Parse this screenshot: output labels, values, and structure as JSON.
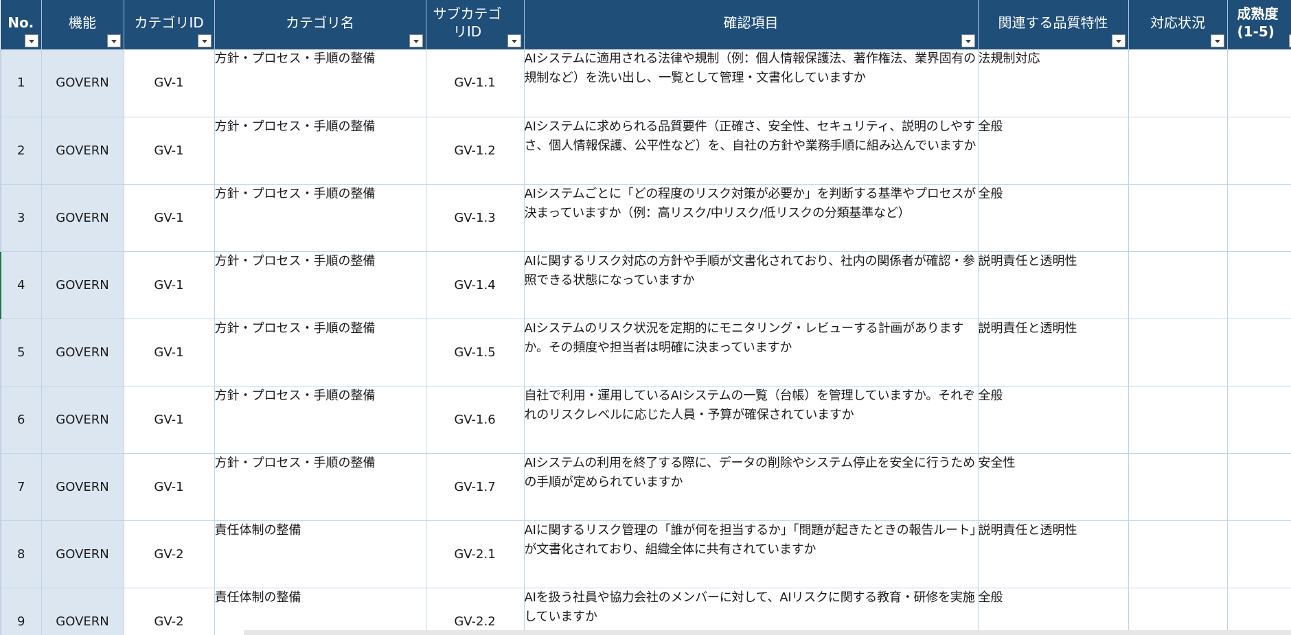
{
  "columns": [
    {
      "label": "No.",
      "bold": true
    },
    {
      "label": "機能",
      "bold": false
    },
    {
      "label": "カテゴリID",
      "bold": false
    },
    {
      "label": "カテゴリ名",
      "bold": false
    },
    {
      "label": "サブカテゴリID",
      "bold": false
    },
    {
      "label": "確認項目",
      "bold": false
    },
    {
      "label": "関連する品質特性",
      "bold": false
    },
    {
      "label": "対応状況",
      "bold": false
    },
    {
      "label": "成熟度(1-5)",
      "bold": false
    }
  ],
  "rows": [
    {
      "no": "1",
      "func": "GOVERN",
      "cat_id": "GV-1",
      "cat_name": "方針・プロセス・手順の整備",
      "sub_id": "GV-1.1",
      "item": "AIシステムに適用される法律や規制（例：個人情報保護法、著作権法、業界固有の規制など）を洗い出し、一覧として管理・文書化していますか",
      "quality": "法規制対応",
      "status": "",
      "maturity": ""
    },
    {
      "no": "2",
      "func": "GOVERN",
      "cat_id": "GV-1",
      "cat_name": "方針・プロセス・手順の整備",
      "sub_id": "GV-1.2",
      "item": "AIシステムに求められる品質要件（正確さ、安全性、セキュリティ、説明のしやすさ、個人情報保護、公平性など）を、自社の方針や業務手順に組み込んでいますか",
      "quality": "全般",
      "status": "",
      "maturity": ""
    },
    {
      "no": "3",
      "func": "GOVERN",
      "cat_id": "GV-1",
      "cat_name": "方針・プロセス・手順の整備",
      "sub_id": "GV-1.3",
      "item": "AIシステムごとに「どの程度のリスク対策が必要か」を判断する基準やプロセスが決まっていますか（例：高リスク/中リスク/低リスクの分類基準など）",
      "quality": "全般",
      "status": "",
      "maturity": ""
    },
    {
      "no": "4",
      "func": "GOVERN",
      "cat_id": "GV-1",
      "cat_name": "方針・プロセス・手順の整備",
      "sub_id": "GV-1.4",
      "item": "AIに関するリスク対応の方針や手順が文書化されており、社内の関係者が確認・参照できる状態になっていますか",
      "quality": "説明責任と透明性",
      "status": "",
      "maturity": ""
    },
    {
      "no": "5",
      "func": "GOVERN",
      "cat_id": "GV-1",
      "cat_name": "方針・プロセス・手順の整備",
      "sub_id": "GV-1.5",
      "item": "AIシステムのリスク状況を定期的にモニタリング・レビューする計画がありますか。その頻度や担当者は明確に決まっていますか",
      "quality": "説明責任と透明性",
      "status": "",
      "maturity": ""
    },
    {
      "no": "6",
      "func": "GOVERN",
      "cat_id": "GV-1",
      "cat_name": "方針・プロセス・手順の整備",
      "sub_id": "GV-1.6",
      "item": "自社で利用・運用しているAIシステムの一覧（台帳）を管理していますか。それぞれのリスクレベルに応じた人員・予算が確保されていますか",
      "quality": "全般",
      "status": "",
      "maturity": ""
    },
    {
      "no": "7",
      "func": "GOVERN",
      "cat_id": "GV-1",
      "cat_name": "方針・プロセス・手順の整備",
      "sub_id": "GV-1.7",
      "item": "AIシステムの利用を終了する際に、データの削除やシステム停止を安全に行うための手順が定められていますか",
      "quality": "安全性",
      "status": "",
      "maturity": ""
    },
    {
      "no": "8",
      "func": "GOVERN",
      "cat_id": "GV-2",
      "cat_name": "責任体制の整備",
      "sub_id": "GV-2.1",
      "item": "AIに関するリスク管理の「誰が何を担当するか」「問題が起きたときの報告ルート」が文書化されており、組織全体に共有されていますか",
      "quality": "説明責任と透明性",
      "status": "",
      "maturity": ""
    },
    {
      "no": "9",
      "func": "GOVERN",
      "cat_id": "GV-2",
      "cat_name": "責任体制の整備",
      "sub_id": "GV-2.2",
      "item": "AIを扱う社員や協力会社のメンバーに対して、AIリスクに関する教育・研修を実施していますか",
      "quality": "全般",
      "status": "",
      "maturity": ""
    }
  ]
}
